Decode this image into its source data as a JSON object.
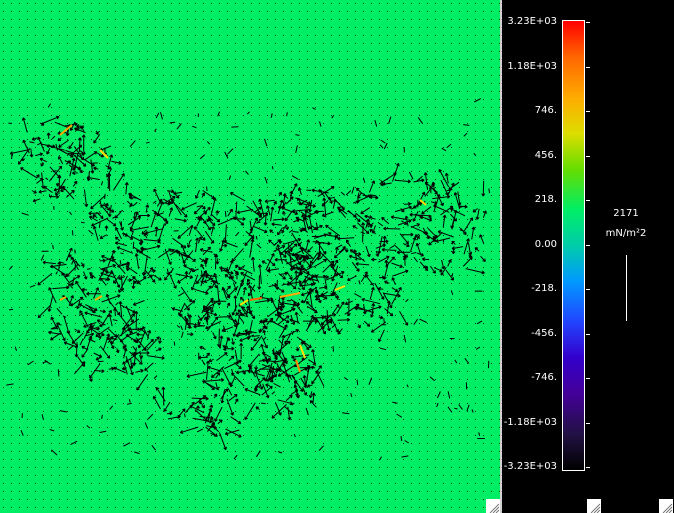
{
  "colorbar": {
    "ticks": [
      "3.23E+03",
      "1.18E+03",
      "746.",
      "456.",
      "218.",
      "0.00",
      "-218.",
      "-456.",
      "-746.",
      "-1.18E+03",
      "-3.23E+03"
    ],
    "colors_top_to_bottom": [
      "#ff0000",
      "#ff6600",
      "#ffaa00",
      "#dddd00",
      "#66dd00",
      "#00ee66",
      "#00ccaa",
      "#0099ff",
      "#2244ff",
      "#3300cc",
      "#440099",
      "#221144",
      "#000000"
    ]
  },
  "scale": {
    "value": "2171",
    "unit": "mN/m²2"
  },
  "plot": {
    "background_color": "#00ee66",
    "dot_color": "#003300"
  }
}
